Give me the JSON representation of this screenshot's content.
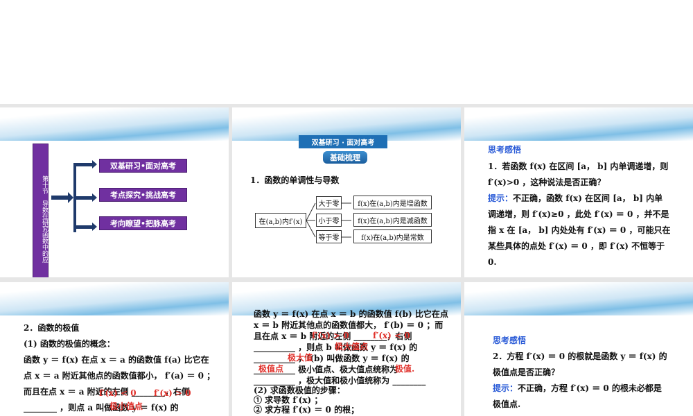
{
  "slide1": {
    "vertical_title": "第十节　导数在研究函数中的应",
    "items": [
      "双基研习•面对高考",
      "考点探究•挑战高考",
      "考向瞭望•把脉高考"
    ],
    "accent": "#7030a0"
  },
  "slide2": {
    "banner": "双基研习 · 面对高考",
    "tag": "基础梳理",
    "heading": "1．函数的单调性与导数",
    "root": "在(a,b)内f′(x)",
    "branches": [
      {
        "cond": "大于零",
        "result": "f(x)在(a,b)内是增函数"
      },
      {
        "cond": "小于零",
        "result": "f(x)在(a,b)内是减函数"
      },
      {
        "cond": "等于零",
        "result": "f(x)在(a,b)内是常数"
      }
    ]
  },
  "slide3": {
    "title": "思考感悟",
    "lines": [
      "1．若函数 f(x) 在区间 [a， b] 内单调递增，则",
      "f′(x)>0 ，这种说法是否正确？"
    ],
    "hint_label": "提示：",
    "hint_lines": [
      "不正确，函数 f(x) 在区间 [a， b] 内单",
      "调递增，则 f′(x)≥0 ，此处 f′(x) ＝ 0 ，并不是",
      "指 x 在 [a， b] 内处处有 f′(x) ＝ 0 ，可能只在",
      "某些具体的点处 f′(x) ＝ 0 ，即 f′(x) 不恒等于",
      "0."
    ]
  },
  "slide4": {
    "lines": [
      "2．函数的极值",
      "(1) 函数的极值的概念：",
      "函数 y ＝ f(x) 在点 x ＝ a 的函数值 f(a) 比它在",
      "点 x ＝ a 附近其他点的函数值都小， f′(a) ＝ 0 ；",
      "而且在点 x ＝ a 附近的左侧 ________，右侧",
      "________ ，则点 a 叫做函数 y ＝ f(x) 的"
    ],
    "answers": [
      "f′(x) < 0",
      "f′(x) > 0",
      "极小值点"
    ]
  },
  "slide5": {
    "lines": [
      "函数 y ＝ f(x) 在点 x ＝ b 的函数值 f(b) 比它在点",
      "x ＝ b 附近其他点的函数值都大， f′(b) ＝ 0 ；而",
      "且在点 x ＝ b 附近的左侧 ________，右侧",
      "__________ ，则点 b 叫做函数 y ＝ f(x) 的",
      "__________ ，f(b) 叫做函数 y ＝ f(x) 的",
      "__________ 极小值点、极大值点统称为",
      "__________ ，极大值和极小值统称为 ________",
      "(2) 求函数极值的步骤：",
      "① 求导数 f′(x) ；",
      "② 求方程 f′(x) ＝ 0 的根；"
    ],
    "answers": [
      "f′(x) > 0",
      "f′(x) < 0",
      "极大值点",
      "极大值",
      "极值点",
      "极值."
    ]
  },
  "slide6": {
    "title": "思考感悟",
    "lines": [
      "2．方程 f′(x) ＝ 0 的根就是函数 y ＝ f(x) 的",
      "极值点是否正确？"
    ],
    "hint_label": "提示：",
    "hint_lines": [
      "不正确，方程 f′(x) ＝ 0 的根未必都是",
      "极值点."
    ]
  }
}
